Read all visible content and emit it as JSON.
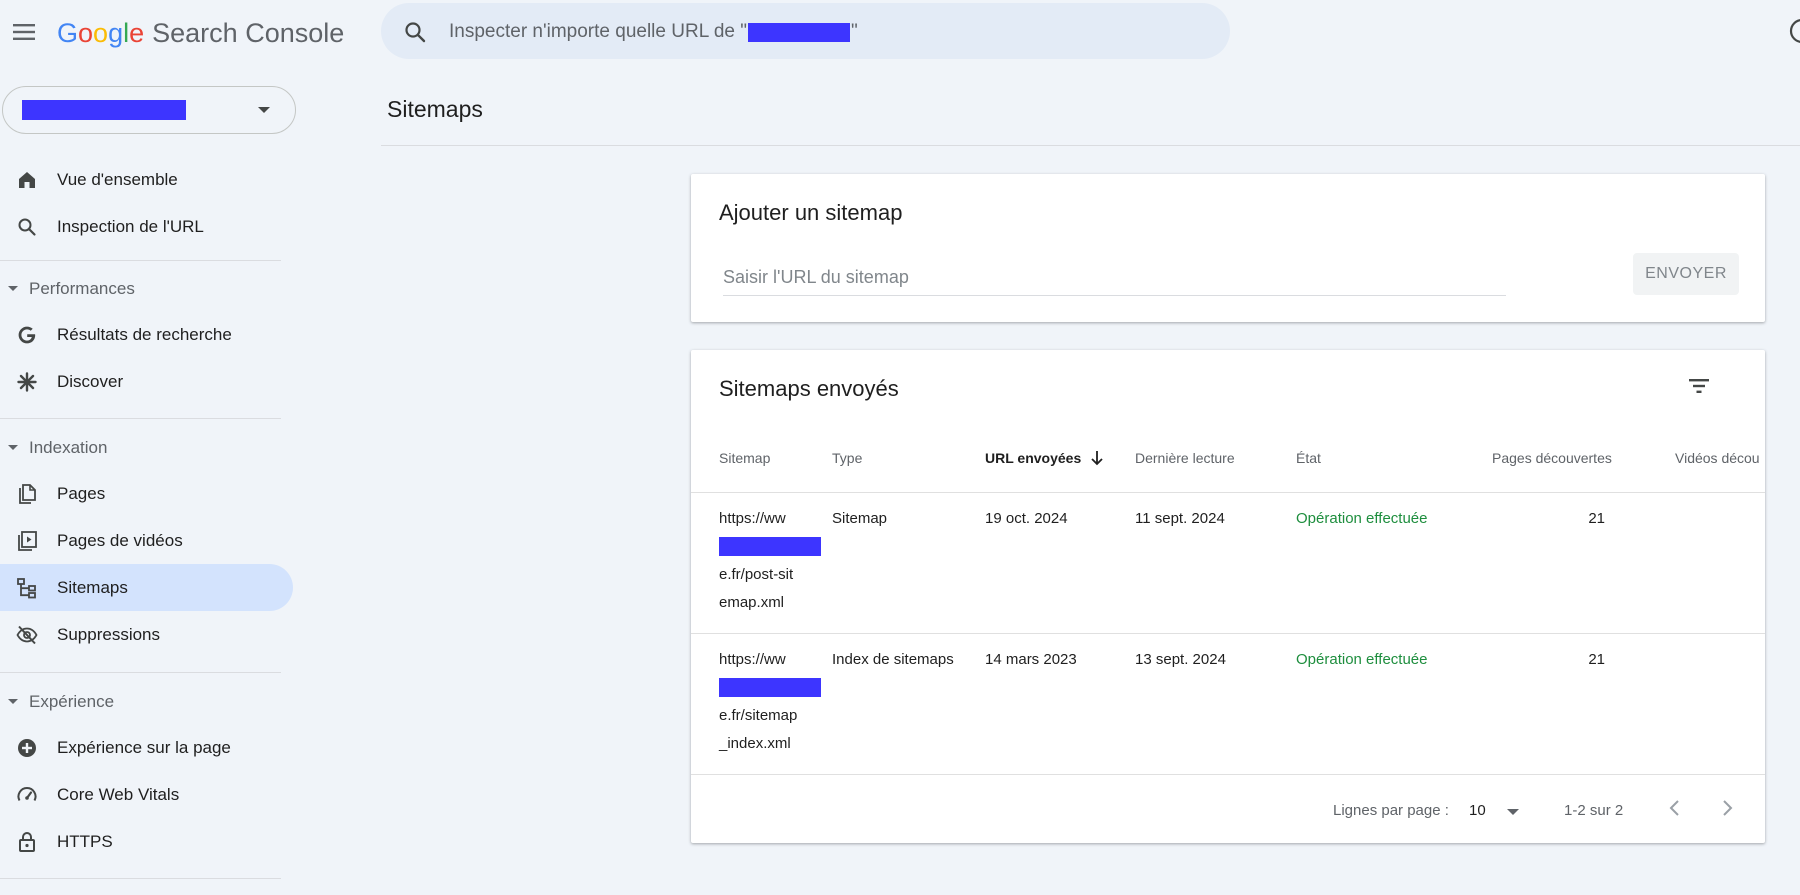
{
  "app": {
    "logo_letters": [
      "G",
      "o",
      "o",
      "g",
      "l",
      "e"
    ],
    "product_name": "Search Console"
  },
  "search": {
    "placeholder_prefix": "Inspecter n'importe quelle URL de \"",
    "placeholder_suffix": "\""
  },
  "sidebar": {
    "items": [
      {
        "label": "Vue d'ensemble",
        "icon": "home-icon"
      },
      {
        "label": "Inspection de l'URL",
        "icon": "search-icon"
      },
      {
        "label": "Résultats de recherche",
        "icon": "google-g-icon"
      },
      {
        "label": "Discover",
        "icon": "asterisk-icon"
      },
      {
        "label": "Pages",
        "icon": "pages-icon"
      },
      {
        "label": "Pages de vidéos",
        "icon": "video-pages-icon"
      },
      {
        "label": "Sitemaps",
        "icon": "sitemap-icon"
      },
      {
        "label": "Suppressions",
        "icon": "eye-off-icon"
      },
      {
        "label": "Expérience sur la page",
        "icon": "plus-circle-icon"
      },
      {
        "label": "Core Web Vitals",
        "icon": "gauge-icon"
      },
      {
        "label": "HTTPS",
        "icon": "lock-icon"
      }
    ],
    "sections": [
      "Performances",
      "Indexation",
      "Expérience"
    ],
    "active_item": "Sitemaps"
  },
  "page": {
    "title": "Sitemaps"
  },
  "add_sitemap": {
    "title": "Ajouter un sitemap",
    "input_placeholder": "Saisir l'URL du sitemap",
    "submit_label": "ENVOYER"
  },
  "submitted": {
    "title": "Sitemaps envoyés",
    "columns": [
      "Sitemap",
      "Type",
      "URL envoyées",
      "Dernière lecture",
      "État",
      "Pages découvertes",
      "Vidéos décou"
    ],
    "sort_column": "URL envoyées",
    "rows": [
      {
        "url_start": "https://ww",
        "url_end_lines": [
          "e.fr/post-sit",
          "emap.xml"
        ],
        "type": "Sitemap",
        "submitted": "19 oct. 2024",
        "last_read": "11 sept. 2024",
        "status": "Opération effectuée",
        "pages": "21"
      },
      {
        "url_start": "https://ww",
        "url_end_lines": [
          "e.fr/sitemap",
          "_index.xml"
        ],
        "type": "Index de sitemaps",
        "submitted": "14 mars 2023",
        "last_read": "13 sept. 2024",
        "status": "Opération effectuée",
        "pages": "21"
      }
    ],
    "pagination": {
      "rows_per_page_label": "Lignes par page :",
      "rows_per_page": "10",
      "range": "1-2 sur 2"
    }
  },
  "colors": {
    "active_nav_bg": "#d3e3fd",
    "success": "#1e8e3e",
    "redaction": "#3d35ff",
    "search_bg": "#e3ebf6"
  }
}
